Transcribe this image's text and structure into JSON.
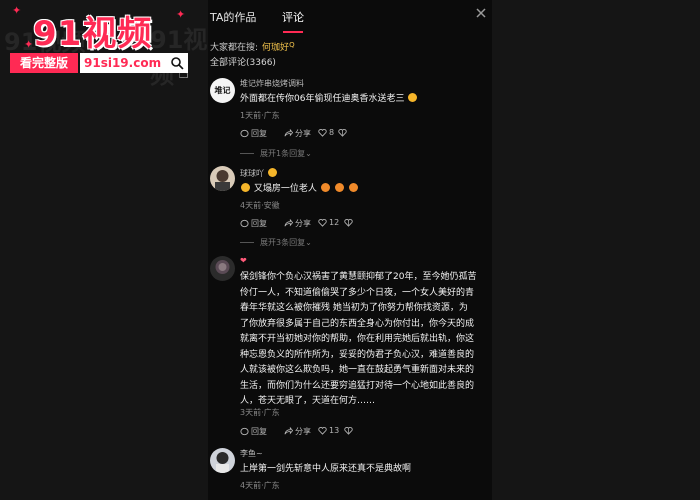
{
  "watermark": {
    "title": "91视频",
    "tag": "看完整版",
    "url": "91si19.com"
  },
  "tabs": {
    "works_label": "TA的作品",
    "comments_label": "评论"
  },
  "search_hint": {
    "prefix": "大家都在搜:",
    "term": "何珈好"
  },
  "total_label": "全部评论(3366)",
  "comments": [
    {
      "name": "堆记炸串烧烤调料",
      "avatar_text": "堆记",
      "text": "外面都在传你06年偷现任迪奥香水送老三",
      "meta": "1天前·广东",
      "reply": "回复",
      "share": "分享",
      "likes": "8",
      "expand": "展开1条回复"
    },
    {
      "name": "球球吖",
      "text": "又塌房一位老人",
      "meta": "4天前·安徽",
      "reply": "回复",
      "share": "分享",
      "likes": "12",
      "expand": "展开3条回复"
    },
    {
      "name": "",
      "text_lines": [
        "保剑锋你个负心汉祸害了黄慧颐抑郁了20年，至今她仍孤苦",
        "伶仃一人，不知道偷偷哭了多少个日夜，一个女人美好的青",
        "春年华就这么被你摧残  她当初为了你努力帮你找资源，为",
        "了你放弃很多属于自己的东西全身心为你付出，你今天的成",
        "就离不开当初她对你的帮助，你在利用完她后就出轨，你这",
        "种忘恩负义的所作所为，妥妥的伪君子负心汉，难道善良的",
        "人就该被你这么欺负吗，她一直在鼓起勇气重新面对未来的",
        "生活，而你们为什么还要穷追猛打对待一个心地如此善良的",
        "人，苍天无眼了，天道在何方……"
      ],
      "meta": "3天前·广东",
      "reply": "回复",
      "share": "分享",
      "likes": "13"
    },
    {
      "name": "李鱼~",
      "text": "上岸第一剑先斩意中人原来还真不是典故啊",
      "meta": "4天前·广东"
    }
  ],
  "colors": {
    "accent": "#ff2a54",
    "search_term": "#f0c14b",
    "background": "#0b0b0b"
  }
}
